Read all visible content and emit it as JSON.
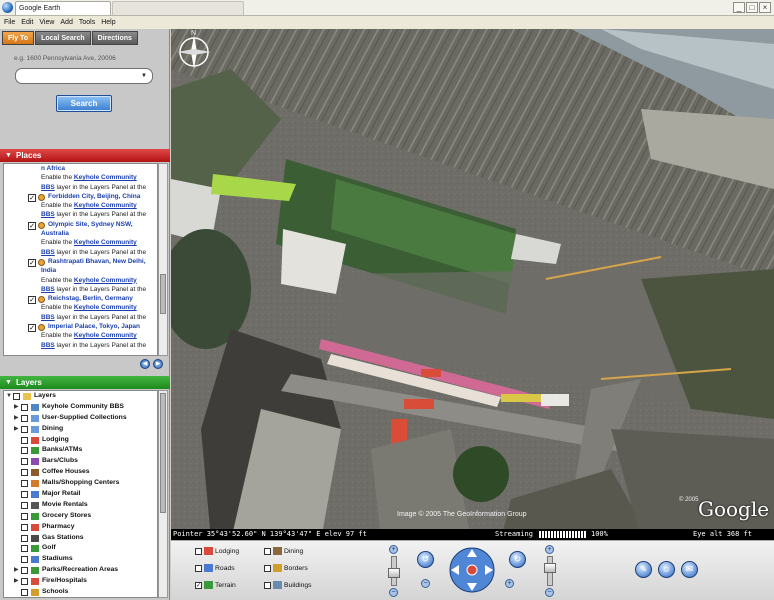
{
  "window": {
    "title": "Google Earth",
    "minimize": "_",
    "restore": "□",
    "close": "×"
  },
  "menu": [
    "File",
    "Edit",
    "View",
    "Add",
    "Tools",
    "Help"
  ],
  "tabs": [
    {
      "label": "Fly To"
    },
    {
      "label": "Local Search"
    },
    {
      "label": "Directions"
    }
  ],
  "search": {
    "hint": "e.g. 1600 Pennsylvania Ave, 20006",
    "value": "",
    "button": "Search"
  },
  "places": {
    "header": "Places",
    "first_line": "n Africa",
    "items": [
      {
        "desc1": "Enable the",
        "link": "Keyhole Community",
        "desc2": "BBS",
        "desc3": "layer in the Layers Panel at the",
        "name": "Forbidden City, Beijing, China"
      },
      {
        "desc1": "Enable the",
        "link": "Keyhole Community",
        "desc2": "BBS",
        "desc3": "layer in the Layers Panel at the",
        "name": "Olympic Site, Sydney NSW, Australia"
      },
      {
        "desc1": "Enable the",
        "link": "Keyhole Community",
        "desc2": "BBS",
        "desc3": "layer in the Layers Panel at the",
        "name": "Rashtrapati Bhavan, New Delhi, India"
      },
      {
        "desc1": "Enable the",
        "link": "Keyhole Community",
        "desc2": "BBS",
        "desc3": "layer in the Layers Panel at the",
        "name": "Reichstag, Berlin, Germany"
      },
      {
        "desc1": "Enable the",
        "link": "Keyhole Community",
        "desc2": "BBS",
        "desc3": "layer in the Layers Panel at the",
        "name": "Imperial Palace, Tokyo, Japan"
      },
      {
        "desc1": "Enable the",
        "link": "Keyhole Community",
        "desc2": "BBS",
        "desc3": "layer in the Layers Panel at the",
        "name": ""
      }
    ]
  },
  "layers": {
    "header": "Layers",
    "items": [
      {
        "label": "Layers",
        "indent": 0,
        "expand": "▼",
        "checked": false,
        "icon": "folder-icon",
        "color": "#e8c24a"
      },
      {
        "label": "Keyhole Community BBS",
        "indent": 1,
        "expand": "▶",
        "checked": false,
        "icon": "globe-icon",
        "color": "#4f86c6"
      },
      {
        "label": "User-Supplied Collections",
        "indent": 1,
        "expand": "▶",
        "checked": false,
        "icon": "folder-icon",
        "color": "#6a9bd8"
      },
      {
        "label": "Dining",
        "indent": 1,
        "expand": "▶",
        "checked": false,
        "icon": "folder-icon",
        "color": "#6a9bd8"
      },
      {
        "label": "Lodging",
        "indent": 1,
        "expand": "",
        "checked": false,
        "icon": "bed-icon",
        "color": "#d94a3a"
      },
      {
        "label": "Banks/ATMs",
        "indent": 1,
        "expand": "",
        "checked": false,
        "icon": "dollar-icon",
        "color": "#3a9a3a"
      },
      {
        "label": "Bars/Clubs",
        "indent": 1,
        "expand": "",
        "checked": false,
        "icon": "glass-icon",
        "color": "#8a4ab0"
      },
      {
        "label": "Coffee Houses",
        "indent": 1,
        "expand": "",
        "checked": false,
        "icon": "cup-icon",
        "color": "#8a5a2a"
      },
      {
        "label": "Malls/Shopping Centers",
        "indent": 1,
        "expand": "",
        "checked": false,
        "icon": "bag-icon",
        "color": "#d07a2a"
      },
      {
        "label": "Major Retail",
        "indent": 1,
        "expand": "",
        "checked": false,
        "icon": "cart-icon",
        "color": "#4a7ad0"
      },
      {
        "label": "Movie Rentals",
        "indent": 1,
        "expand": "",
        "checked": false,
        "icon": "film-icon",
        "color": "#555555"
      },
      {
        "label": "Grocery Stores",
        "indent": 1,
        "expand": "",
        "checked": false,
        "icon": "basket-icon",
        "color": "#3a9a3a"
      },
      {
        "label": "Pharmacy",
        "indent": 1,
        "expand": "",
        "checked": false,
        "icon": "pill-icon",
        "color": "#d94a3a"
      },
      {
        "label": "Gas Stations",
        "indent": 1,
        "expand": "",
        "checked": false,
        "icon": "fuel-icon",
        "color": "#4a4a4a"
      },
      {
        "label": "Golf",
        "indent": 1,
        "expand": "",
        "checked": false,
        "icon": "golf-icon",
        "color": "#3a9a3a"
      },
      {
        "label": "Stadiums",
        "indent": 1,
        "expand": "",
        "checked": false,
        "icon": "stadium-icon",
        "color": "#4a7ad0"
      },
      {
        "label": "Parks/Recreation Areas",
        "indent": 1,
        "expand": "▶",
        "checked": false,
        "icon": "tree-icon",
        "color": "#3a9a3a"
      },
      {
        "label": "Fire/Hospitals",
        "indent": 1,
        "expand": "▶",
        "checked": false,
        "icon": "cross-icon",
        "color": "#d94a3a"
      },
      {
        "label": "Schools",
        "indent": 1,
        "expand": "",
        "checked": false,
        "icon": "school-icon",
        "color": "#d0a02a"
      }
    ]
  },
  "status": {
    "pointer": "Pointer  35°43'52.60\" N  139°43'47\" E  elev  97 ft",
    "streaming": "Streaming",
    "percent": "100%",
    "eye_alt": "Eye  alt   368 ft",
    "streaming_level": 1.0
  },
  "map": {
    "copyright": "Image © 2005 The GeoInformation Group",
    "year": "© 2005",
    "logo": "Google"
  },
  "bottom_layers": [
    {
      "label": "Lodging",
      "checked": false,
      "icon": "bed-icon"
    },
    {
      "label": "Dining",
      "checked": false,
      "icon": "fork-icon"
    },
    {
      "label": "Roads",
      "checked": false,
      "icon": "road-icon"
    },
    {
      "label": "Borders",
      "checked": false,
      "icon": "border-icon"
    },
    {
      "label": "Terrain",
      "checked": true,
      "icon": "terrain-icon"
    },
    {
      "label": "Buildings",
      "checked": false,
      "icon": "building-icon"
    }
  ],
  "colors": {
    "fly_to_tab": "#e08a2a",
    "places_header": "#c81e1e",
    "layers_header": "#2a9a2a",
    "link": "#1a3fb0"
  }
}
